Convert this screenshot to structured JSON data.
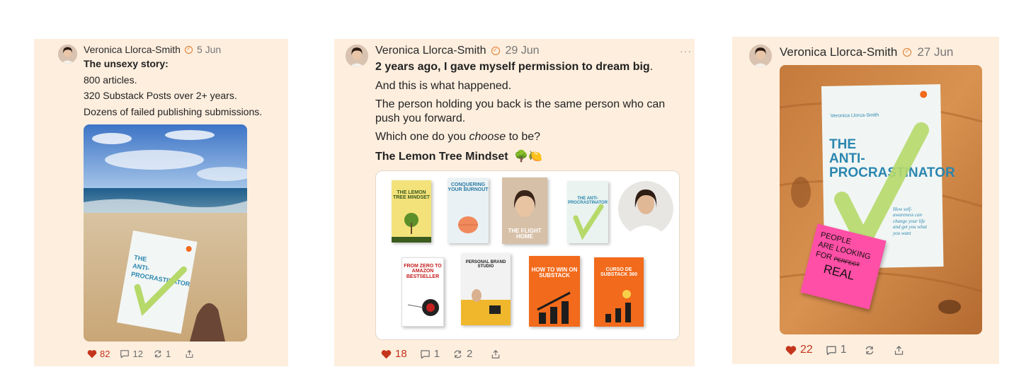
{
  "posts": [
    {
      "author": "Veronica Llorca-Smith",
      "date": "5 Jun",
      "lines": [
        "The unsexy story:",
        "800 articles.",
        "320 Substack Posts over 2+ years.",
        "Dozens of failed publishing submissions."
      ],
      "image": {
        "book_author": "Veronica Llorca-Smith",
        "book_title": "THE ANTI-PROCRASTINATOR"
      },
      "likes": "82",
      "comments": "12",
      "restacks": "1"
    },
    {
      "author": "Veronica Llorca-Smith",
      "date": "29 Jun",
      "menu": "···",
      "headline": "2 years ago, I gave myself permission to dream big",
      "headline_end": ".",
      "lines": [
        "And this is what happened.",
        "The person holding you back is the same person who can",
        "push you forward.",
        "Which one do you ",
        "choose",
        " to be?",
        "The Lemon Tree Mindset",
        "🌳🍋"
      ],
      "books": [
        {
          "title": "THE LEMON TREE MINDSET",
          "bg": "#f3e27a",
          "fg": "#3c5b1f"
        },
        {
          "title": "CONQUERING YOUR BURNOUT",
          "bg": "#e9f1f4",
          "fg": "#2b7aa3"
        },
        {
          "title": "THE FLIGHT HOME",
          "bg": "#d7c0a8",
          "fg": "#ffffff"
        },
        {
          "title": "THE ANTI-PROCRASTINATOR",
          "bg": "#eaf3ef",
          "fg": "#2b86b0"
        },
        {
          "title": "FROM ZERO TO AMAZON BESTSELLER",
          "bg": "#ffffff",
          "fg": "#c52020"
        },
        {
          "title": "PERSONAL BRAND STUDIO",
          "bg": "#f2f2f2",
          "fg": "#222222"
        },
        {
          "title": "HOW TO WIN ON SUBSTACK",
          "bg": "#f26a1b",
          "fg": "#ffffff"
        },
        {
          "title": "CURSO DE SUBSTACK 360",
          "bg": "#f26a1b",
          "fg": "#ffffff"
        }
      ],
      "likes": "18",
      "comments": "1",
      "restacks": "2"
    },
    {
      "author": "Veronica Llorca-Smith",
      "date": "27 Jun",
      "image": {
        "book_author": "Veronica Llorca-Smith",
        "book_title_1": "THE",
        "book_title_2": "ANTI-",
        "book_title_3": "PROCRASTINATOR",
        "subtitle": "How self-awareness can change your life and get you what you want",
        "note_1": "PEOPLE",
        "note_2": "ARE LOOKING",
        "note_3": "FOR",
        "note_struck": "PERFECT",
        "note_4": "REAL"
      },
      "likes": "22",
      "comments": "1"
    }
  ],
  "colors": {
    "card_bg": "#fdeede",
    "like": "#c4351c",
    "verified": "#e07a2c"
  },
  "icons": [
    "heart-icon",
    "comment-icon",
    "restack-icon",
    "share-icon",
    "verified-icon",
    "more-icon"
  ]
}
